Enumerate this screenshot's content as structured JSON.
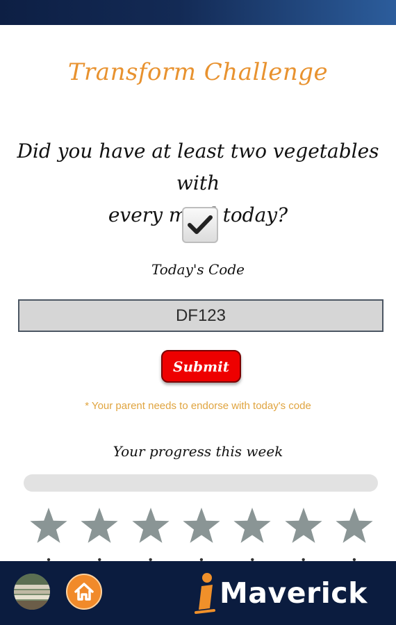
{
  "header": {
    "title": "Transform Challenge"
  },
  "question": {
    "line1": "Did you have at least two vegetables with",
    "line2": "every meal today?",
    "checked": true
  },
  "code": {
    "label": "Today's Code",
    "value": "DF123"
  },
  "submit_label": "Submit",
  "note": "* Your parent needs to endorse with today's code",
  "progress": {
    "label": "Your progress this week",
    "fraction": 0,
    "stars_total": 7,
    "stars_filled": 0,
    "colors": {
      "empty_star": "#8a9595",
      "track": "#e2e2e2"
    }
  },
  "footer": {
    "brand_prefix": "i",
    "brand_name": "Maverick",
    "home_icon": "home-icon",
    "avatar": "profile-avatar"
  }
}
